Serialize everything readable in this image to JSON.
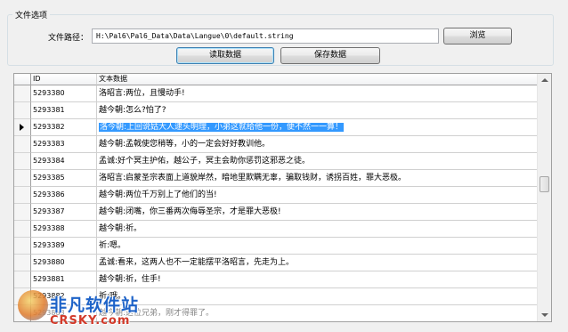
{
  "file_options": {
    "group_title": "文件选项",
    "path_label": "文件路径：",
    "path_value": "H:\\Pal6\\Pal6_Data\\Data\\Langue\\0\\default.string",
    "browse_label": "浏览",
    "read_label": "读取数据",
    "save_label": "保存数据"
  },
  "grid": {
    "columns": [
      "ID",
      "文本数据"
    ],
    "rows": [
      {
        "id": "5293380",
        "text": "洛昭言:两位，且慢动手!"
      },
      {
        "id": "5293381",
        "text": "越今朝:怎么?怕了?"
      },
      {
        "id": "5293382",
        "text": "洛今朝:上回说姑大人逮头明理，小弟这就给他一份，便不然一一算！"
      },
      {
        "id": "5293383",
        "text": "越今朝:孟戟使您稍等，小的一定会好好教训他。"
      },
      {
        "id": "5293384",
        "text": "孟诚:好个冥主护佑，越公子，冥主会助你惩罚这邪恶之徒。"
      },
      {
        "id": "5293385",
        "text": "洛昭言:启蒙圣宗表面上道貌岸然，暗地里欺瞒无辜，骗取钱财，诱拐百姓，罪大恶极。"
      },
      {
        "id": "5293386",
        "text": "越今朝:两位千万别上了他们的当!"
      },
      {
        "id": "5293387",
        "text": "越今朝:闭嘴，你三番两次侮辱圣宗，才是罪大恶极!"
      },
      {
        "id": "5293388",
        "text": "越今朝:祈。"
      },
      {
        "id": "5293389",
        "text": "祈:嗯。"
      },
      {
        "id": "5293880",
        "text": "孟诚:看来，这两人也不一定能摆平洛昭言，先走为上。"
      },
      {
        "id": "5293881",
        "text": "越今朝:祈，住手!"
      },
      {
        "id": "5293882",
        "text": "祈:哦。"
      },
      {
        "id": "5293883",
        "text": "越今朝:这位兄弟，刚才得罪了。"
      }
    ],
    "selected_index": 2
  },
  "watermark": {
    "name": "非凡软件站",
    "url": "CRSKY.com"
  },
  "colors": {
    "selection": "#3399ff",
    "watermark_blue": "#1e63c8",
    "watermark_red": "#d23a2a"
  }
}
